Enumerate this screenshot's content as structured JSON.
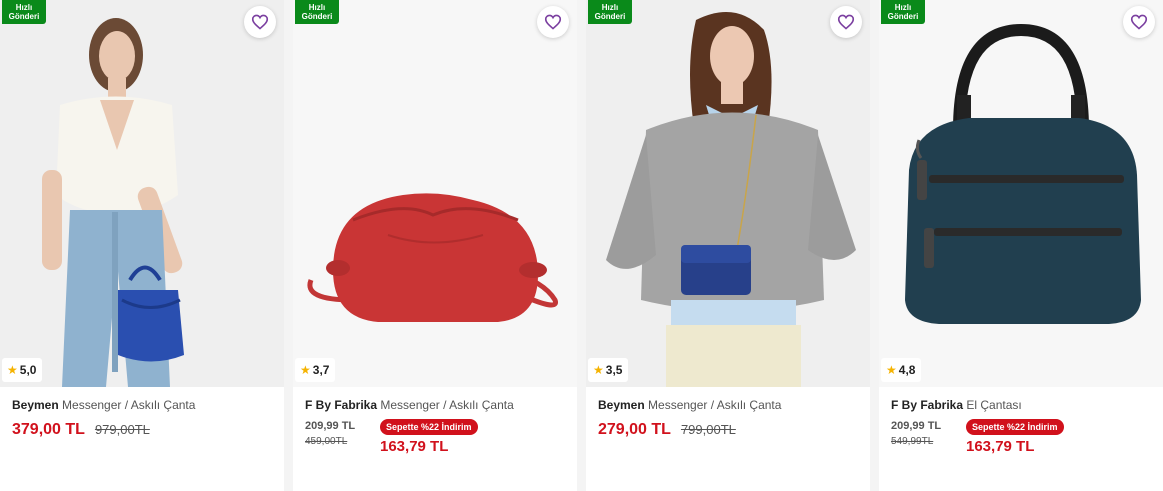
{
  "products": [
    {
      "fast_label_1": "Hızlı",
      "fast_label_2": "Gönderi",
      "rating": "5,0",
      "brand": "Beymen",
      "category": "Messenger / Askılı Çanta",
      "price": "379,00 TL",
      "old_price": "979,00TL"
    },
    {
      "fast_label_1": "Hızlı",
      "fast_label_2": "Gönderi",
      "rating": "3,7",
      "brand": "F By Fabrika",
      "category": "Messenger / Askılı Çanta",
      "list_price": "209,99 TL",
      "original_price": "459,00TL",
      "promo_badge": "Sepette %22 İndirim",
      "promo_price": "163,79 TL"
    },
    {
      "fast_label_1": "Hızlı",
      "fast_label_2": "Gönderi",
      "rating": "3,5",
      "brand": "Beymen",
      "category": "Messenger / Askılı Çanta",
      "price": "279,00 TL",
      "old_price": "799,00TL"
    },
    {
      "fast_label_1": "Hızlı",
      "fast_label_2": "Gönderi",
      "rating": "4,8",
      "brand": "F By Fabrika",
      "category": "El Çantası",
      "list_price": "209,99 TL",
      "original_price": "549,99TL",
      "promo_badge": "Sepette %22 İndirim",
      "promo_price": "163,79 TL"
    }
  ],
  "icons": {
    "favorite": "heart-outline-icon",
    "rating": "star-icon"
  },
  "colors": {
    "fast_badge": "#0a8a1a",
    "price_red": "#d1111c",
    "favorite_purple": "#7b3fa0",
    "star": "#f5b301"
  }
}
